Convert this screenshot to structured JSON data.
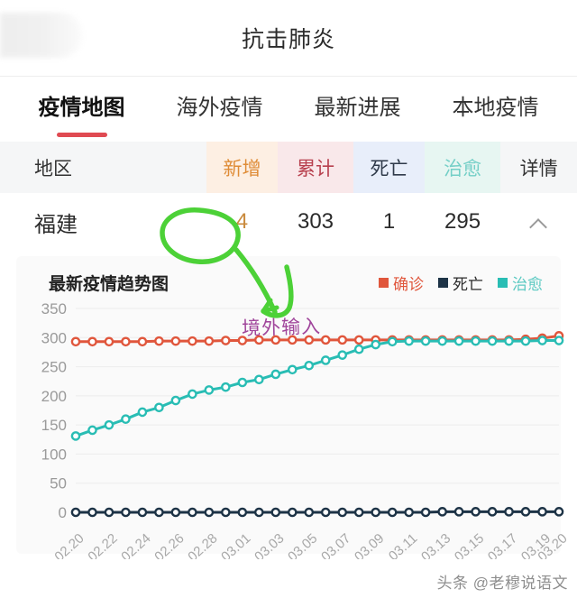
{
  "header": {
    "title": "抗击肺炎"
  },
  "tabs": [
    {
      "label": "疫情地图",
      "active": true
    },
    {
      "label": "海外疫情",
      "active": false
    },
    {
      "label": "最新进展",
      "active": false
    },
    {
      "label": "本地疫情",
      "active": false
    }
  ],
  "table": {
    "columns": [
      "地区",
      "新增",
      "累计",
      "死亡",
      "治愈",
      "详情"
    ],
    "rows": [
      {
        "region": "福建",
        "new": "4",
        "total": "303",
        "death": "1",
        "cured": "295",
        "detail_icon": "chevron-up-icon"
      }
    ],
    "colors": {
      "new_bg": "#fdefe3",
      "new_fg": "#df8c37",
      "total_bg": "#f9e8ea",
      "total_fg": "#b8414f",
      "death_bg": "#e8eefa",
      "death_fg": "#2f3a4a",
      "cured_bg": "#e7f6f2",
      "cured_fg": "#74cfc7",
      "header_bg": "#f5f6f7"
    }
  },
  "chart_card": {
    "title": "最新疫情趋势图",
    "legend": [
      {
        "label": "确诊",
        "color": "#e0563c"
      },
      {
        "label": "死亡",
        "color": "#1d3346"
      },
      {
        "label": "治愈",
        "color": "#29bdb4"
      }
    ]
  },
  "annotations": {
    "circle_target": "4",
    "note_text": "境外输入",
    "note_color": "#a0459b",
    "pen_color": "#4cd137"
  },
  "watermark": {
    "text": "头条 @老穆说语文"
  },
  "chart_data": {
    "type": "line",
    "title": "最新疫情趋势图",
    "xlabel": "",
    "ylabel": "",
    "ylim": [
      0,
      350
    ],
    "yticks": [
      0,
      50,
      100,
      150,
      200,
      250,
      300,
      350
    ],
    "grid": true,
    "legend_position": "top-right",
    "x": [
      "02.20",
      "02.21",
      "02.22",
      "02.23",
      "02.24",
      "02.25",
      "02.26",
      "02.27",
      "02.28",
      "02.29",
      "03.01",
      "03.02",
      "03.03",
      "03.04",
      "03.05",
      "03.06",
      "03.07",
      "03.08",
      "03.09",
      "03.10",
      "03.11",
      "03.12",
      "03.13",
      "03.14",
      "03.15",
      "03.16",
      "03.17",
      "03.18",
      "03.19",
      "03.20"
    ],
    "xticklabels": [
      "02.20",
      "02.22",
      "02.24",
      "02.26",
      "02.28",
      "03.01",
      "03.03",
      "03.05",
      "03.07",
      "03.09",
      "03.11",
      "03.13",
      "03.15",
      "03.17",
      "03.20"
    ],
    "series": [
      {
        "name": "确诊",
        "color": "#e0563c",
        "values": [
          293,
          293,
          293,
          293,
          293,
          294,
          294,
          294,
          294,
          295,
          295,
          296,
          296,
          296,
          296,
          296,
          296,
          296,
          296,
          296,
          296,
          296,
          296,
          296,
          296,
          296,
          296,
          297,
          299,
          303
        ]
      },
      {
        "name": "死亡",
        "color": "#1d3346",
        "values": [
          0,
          0,
          0,
          0,
          0,
          0,
          0,
          0,
          0,
          0,
          0,
          0,
          0,
          0,
          0,
          0,
          0,
          0,
          0,
          0,
          0,
          0,
          1,
          1,
          1,
          1,
          1,
          1,
          1,
          1
        ]
      },
      {
        "name": "治愈",
        "color": "#29bdb4",
        "values": [
          131,
          141,
          150,
          160,
          172,
          180,
          192,
          203,
          210,
          215,
          223,
          228,
          237,
          245,
          252,
          261,
          270,
          280,
          288,
          293,
          294,
          294,
          294,
          294,
          294,
          294,
          294,
          294,
          295,
          295
        ]
      }
    ]
  }
}
